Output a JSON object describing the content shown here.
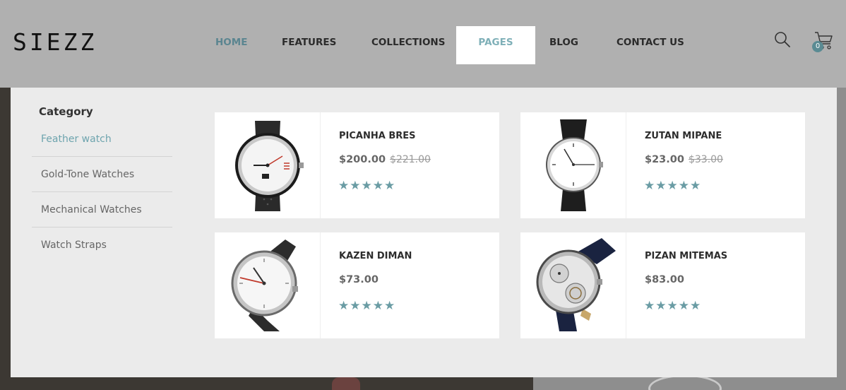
{
  "brand": {
    "logo": "SIEZZ"
  },
  "nav": {
    "items": [
      {
        "label": "HOME"
      },
      {
        "label": "FEATURES"
      },
      {
        "label": "COLLECTIONS"
      },
      {
        "label": "PAGES"
      },
      {
        "label": "BLOG"
      },
      {
        "label": "CONTACT US"
      }
    ],
    "active_item": "HOME",
    "open_item": "PAGES"
  },
  "cart": {
    "count": "0"
  },
  "colors": {
    "accent": "#5b8590",
    "star": "#6a9ca4",
    "header_bg": "#b0b0b0",
    "panel_bg": "#ebebeb"
  },
  "icons": {
    "search": "search-icon",
    "cart": "cart-icon",
    "star": "star-icon"
  },
  "menu": {
    "category_title": "Category",
    "categories": [
      {
        "label": "Feather watch"
      },
      {
        "label": "Gold-Tone Watches"
      },
      {
        "label": "Mechanical Watches"
      },
      {
        "label": "Watch Straps"
      }
    ],
    "active_category": "Feather watch",
    "products": [
      {
        "name": "PICANHA BRES",
        "price": "$200.00",
        "old_price": "$221.00",
        "rating": 5,
        "stars": "★★★★★"
      },
      {
        "name": "ZUTAN MIPANE",
        "price": "$23.00",
        "old_price": "$33.00",
        "rating": 5,
        "stars": "★★★★★"
      },
      {
        "name": "KAZEN DIMAN",
        "price": "$73.00",
        "old_price": "",
        "rating": 5,
        "stars": "★★★★★"
      },
      {
        "name": "PIZAN MITEMAS",
        "price": "$83.00",
        "old_price": "",
        "rating": 5,
        "stars": "★★★★★"
      }
    ]
  }
}
